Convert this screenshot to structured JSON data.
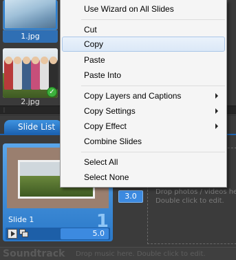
{
  "browser": {
    "files": [
      {
        "name": "1.jpg"
      },
      {
        "name": "2.jpg"
      }
    ]
  },
  "storyboard": {
    "tab_label": "Slide List",
    "slide": {
      "number": "1",
      "name": "Slide 1",
      "duration": "5.0"
    },
    "transition_duration": "3.0",
    "drop_hint_line1": "Drop photos / videos here",
    "drop_hint_line2": "Double click to edit."
  },
  "soundtrack": {
    "label": "Soundtrack",
    "hint": "Drop music here.  Double click to edit."
  },
  "context_menu": {
    "items": [
      {
        "label": "Use Wizard on All Slides",
        "submenu": false
      },
      {
        "label": "Cut",
        "submenu": false
      },
      {
        "label": "Copy",
        "submenu": false,
        "highlighted": true
      },
      {
        "label": "Paste",
        "submenu": false
      },
      {
        "label": "Paste Into",
        "submenu": false
      },
      {
        "label": "Copy Layers and Captions",
        "submenu": true
      },
      {
        "label": "Copy Settings",
        "submenu": true
      },
      {
        "label": "Copy Effect",
        "submenu": true
      },
      {
        "label": "Combine Slides",
        "submenu": false
      },
      {
        "label": "Select All",
        "submenu": false
      },
      {
        "label": "Select None",
        "submenu": false
      }
    ]
  },
  "colors": {
    "accent": "#2f6fb4",
    "menu_bg": "#f5f5f5",
    "highlight": "#dbe8f7",
    "check": "#3db23d"
  }
}
